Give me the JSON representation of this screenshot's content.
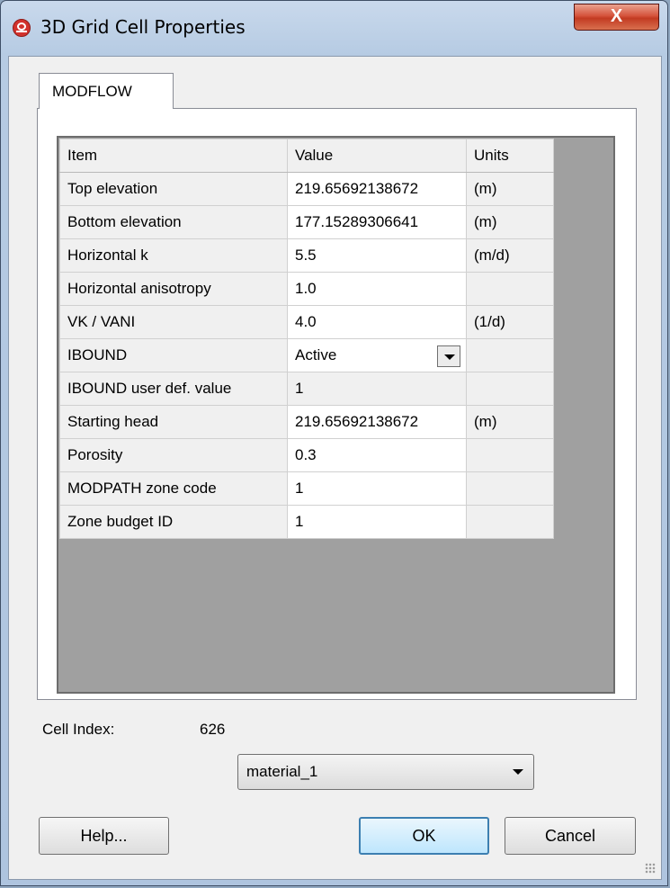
{
  "window": {
    "title": "3D Grid Cell Properties",
    "close_label": "X"
  },
  "tabs": [
    {
      "label": "MODFLOW"
    }
  ],
  "table": {
    "headers": [
      "Item",
      "Value",
      "Units"
    ],
    "rows": [
      {
        "item": "Top elevation",
        "value": "219.65692138672",
        "units": "(m)"
      },
      {
        "item": "Bottom elevation",
        "value": "177.15289306641",
        "units": "(m)"
      },
      {
        "item": "Horizontal k",
        "value": "5.5",
        "units": "(m/d)"
      },
      {
        "item": "Horizontal anisotropy",
        "value": "1.0",
        "units": ""
      },
      {
        "item": "VK / VANI",
        "value": "4.0",
        "units": "(1/d)"
      },
      {
        "item": "IBOUND",
        "value": "Active",
        "units": ""
      },
      {
        "item": "IBOUND user def. value",
        "value": "1",
        "units": ""
      },
      {
        "item": "Starting head",
        "value": "219.65692138672",
        "units": "(m)"
      },
      {
        "item": "Porosity",
        "value": "0.3",
        "units": ""
      },
      {
        "item": "MODPATH zone code",
        "value": "1",
        "units": ""
      },
      {
        "item": "Zone budget ID",
        "value": "1",
        "units": ""
      }
    ]
  },
  "cell_index": {
    "label": "Cell Index:",
    "value": "626"
  },
  "material": {
    "selected": "material_1"
  },
  "buttons": {
    "help": "Help...",
    "ok": "OK",
    "cancel": "Cancel"
  }
}
